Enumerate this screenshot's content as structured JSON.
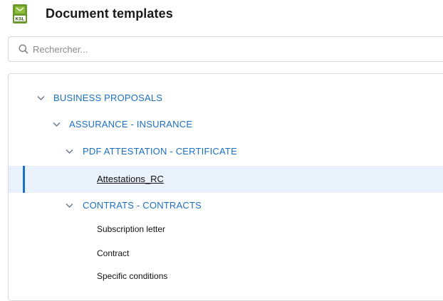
{
  "header": {
    "title": "Document templates",
    "logo_text": "KSL",
    "logo_icon": "document-template-icon"
  },
  "search": {
    "placeholder": "Rechercher..."
  },
  "tree": {
    "business_proposals": "BUSINESS PROPOSALS",
    "assurance_insurance": "ASSURANCE - INSURANCE",
    "pdf_attestation": "PDF ATTESTATION - CERTIFICATE",
    "attestations_rc": "Attestations_RC",
    "contrats_contracts": "CONTRATS - CONTRACTS",
    "subscription_letter": "Subscription letter",
    "contract": "Contract",
    "specific_conditions": "Specific conditions"
  },
  "colors": {
    "link_blue": "#1a6fc2",
    "selection_bg": "#e9f1fb",
    "logo_green": "#6a9a2a"
  }
}
